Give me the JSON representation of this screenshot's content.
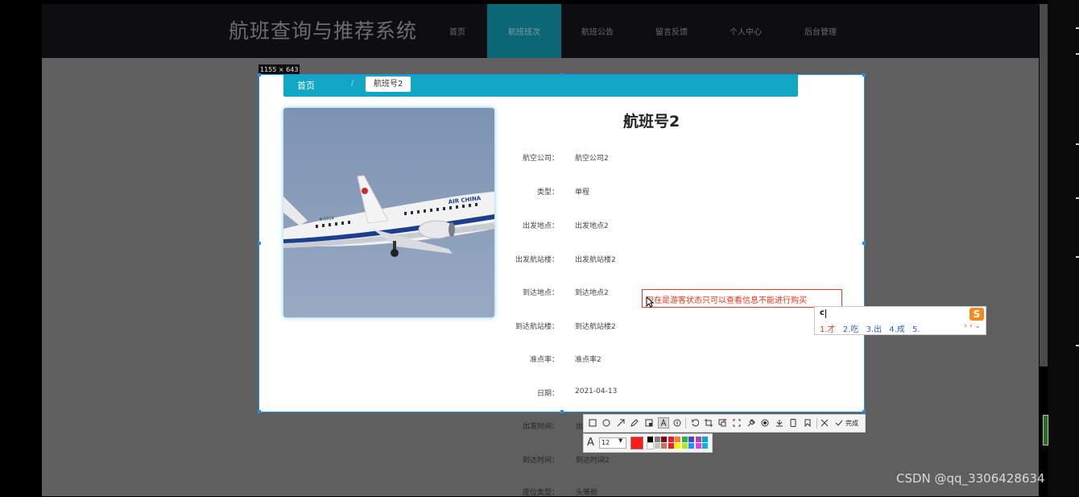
{
  "site": {
    "title": "航班查询与推荐系统",
    "nav": [
      {
        "label": "首页"
      },
      {
        "label": "航班班次",
        "active": true
      },
      {
        "label": "航班公告"
      },
      {
        "label": "留言反馈"
      },
      {
        "label": "个人中心"
      },
      {
        "label": "后台管理"
      }
    ]
  },
  "capture": {
    "size_tip": "1155 × 643"
  },
  "breadcrumb": {
    "home": "首页",
    "separator": "/",
    "current": "航班号2"
  },
  "detail": {
    "title": "航班号2",
    "fields": [
      {
        "label": "航空公司：",
        "value": "航空公司2"
      },
      {
        "label": "类型：",
        "value": "单程"
      },
      {
        "label": "出发地点：",
        "value": "出发地点2"
      },
      {
        "label": "出发航站楼：",
        "value": "出发航站楼2"
      },
      {
        "label": "到达地点：",
        "value": "到达地点2"
      },
      {
        "label": "到达航站楼：",
        "value": "到达航站楼2"
      },
      {
        "label": "准点率：",
        "value": "准点率2"
      },
      {
        "label": "日期：",
        "value": "2021-04-13"
      }
    ],
    "dimmed_fields": [
      {
        "label": "出发时间：",
        "value": "出"
      },
      {
        "label": "到达时间：",
        "value": "到达时间2"
      },
      {
        "label": "座位类型：",
        "value": "头等舱"
      }
    ],
    "plane_livery_text": "AIR CHINA",
    "plane_registration": "B-5514"
  },
  "annotation": {
    "text": "现在是游客状态只可以查看信息不能进行购买"
  },
  "ime": {
    "input": "c",
    "candidates": [
      "1.才",
      "2.吃",
      "3.出",
      "4.成",
      "5."
    ],
    "logo": "S",
    "nav": "‹ › ⌄"
  },
  "toolbar": {
    "finish_label": "完成",
    "tools": [
      "rectangle-icon",
      "ellipse-icon",
      "arrow-icon",
      "pencil-icon",
      "mosaic-icon",
      "text-tool-icon",
      "serial-number-icon",
      "undo-icon",
      "crop-icon",
      "translate-icon",
      "scan-icon",
      "pin-icon",
      "record-icon",
      "save-icon",
      "phone-icon",
      "bookmark-icon",
      "close-icon",
      "check-icon"
    ]
  },
  "style_bar": {
    "font_size": "12",
    "current_color": "#ff1a1a",
    "palette": [
      "#000000",
      "#7f7f7f",
      "#880015",
      "#ed1c24",
      "#ff7f27",
      "#22b14c",
      "#3f48cc",
      "#a349a4",
      "#00a2e8",
      "#ffffff",
      "#c3c3c3",
      "#b97a57",
      "#ff1a1a",
      "#fff200",
      "#b5e61d",
      "#1e90ff",
      "#e040fb",
      "#00bcd4"
    ]
  },
  "watermark": "CSDN @qq_3306428634"
}
